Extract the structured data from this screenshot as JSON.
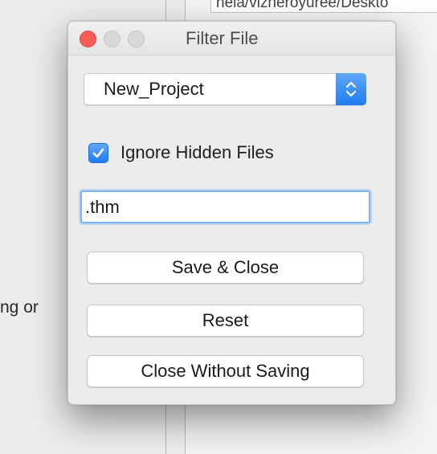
{
  "background": {
    "path_text": "hela/vizheroyuree/Deskto",
    "label_fragment": "ng or"
  },
  "dialog": {
    "title": "Filter File",
    "project_select": {
      "selected": "New_Project"
    },
    "ignore_hidden": {
      "label": "Ignore Hidden Files",
      "checked": true
    },
    "filter_field": {
      "value": ".thm"
    },
    "buttons": {
      "save_close": "Save & Close",
      "reset": "Reset",
      "close_without_saving": "Close Without Saving"
    }
  },
  "colors": {
    "accent": "#2b84f2",
    "close_light": "#fc5d57",
    "inactive_light": "#d8d8d8"
  },
  "icons": {
    "popup": "up-down-chevron-icon",
    "checkbox": "checkmark-icon"
  }
}
